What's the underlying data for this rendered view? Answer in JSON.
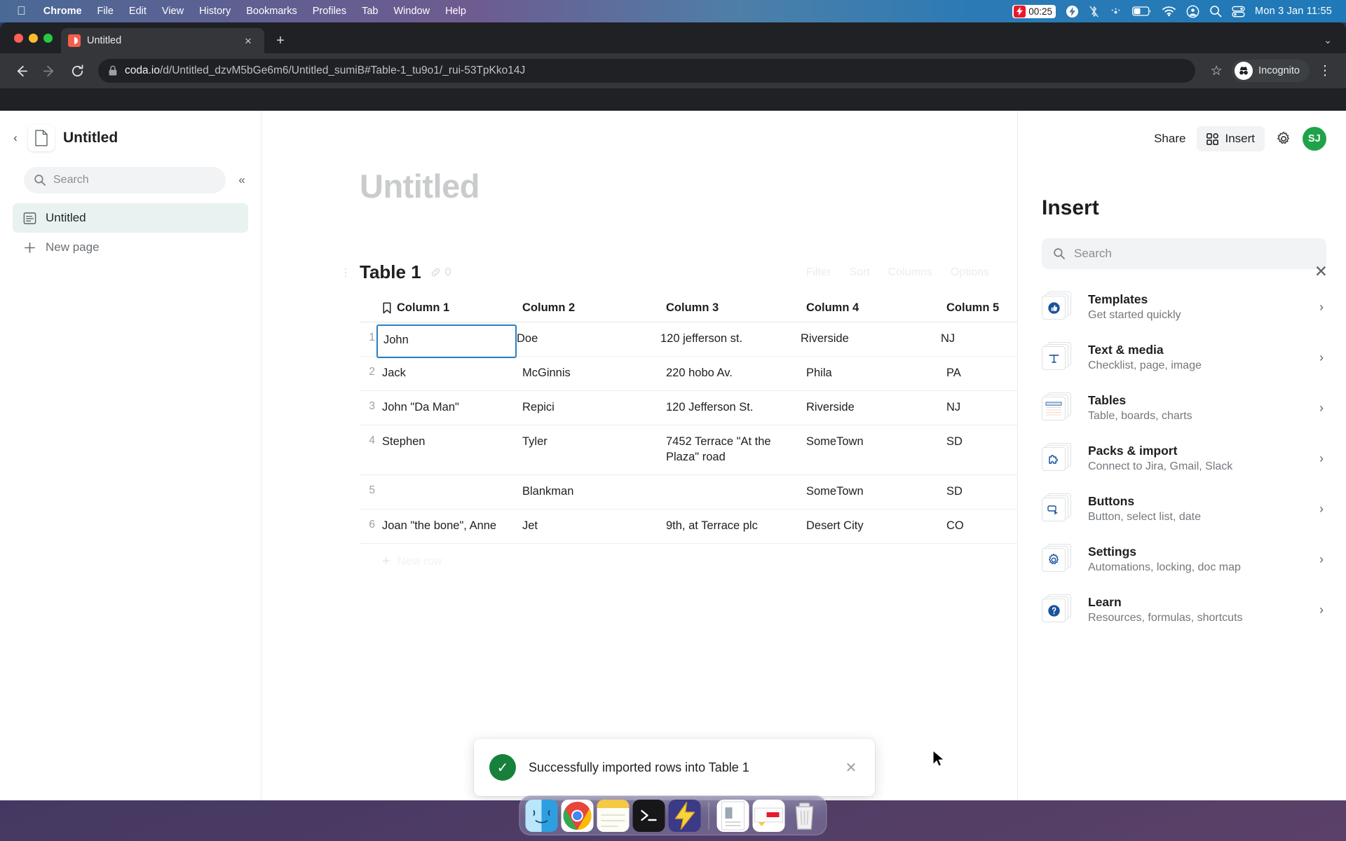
{
  "menubar": {
    "apple_icon": "apple-logo",
    "items": [
      "Chrome",
      "File",
      "Edit",
      "View",
      "History",
      "Bookmarks",
      "Profiles",
      "Tab",
      "Window",
      "Help"
    ],
    "recording_time": "00:25",
    "status_icons": [
      "screen-recording-icon",
      "bolt-icon",
      "bluetooth-icon",
      "brightness-icon",
      "battery-icon",
      "wifi-icon",
      "control-center-icon",
      "spotlight-icon",
      "toggles-icon"
    ],
    "datetime": "Mon 3 Jan  11:55"
  },
  "browser": {
    "tab_title": "Untitled",
    "tab_close_glyph": "×",
    "new_tab_glyph": "+",
    "tabstrip_chevron": "⌄",
    "url_host": "coda.io",
    "url_path": "/d/Untitled_dzvM5bGe6m6/Untitled_sumiB#Table-1_tu9o1/_rui-53TpKko14J",
    "profile_label": "Incognito",
    "bookmark_glyph": "☆",
    "menu_glyph": "⋮"
  },
  "sidebar": {
    "back_glyph": "‹",
    "doc_title": "Untitled",
    "search_placeholder": "Search",
    "collapse_glyph": "«",
    "items": [
      {
        "label": "Untitled",
        "icon": "page-icon",
        "active": true
      },
      {
        "label": "New page",
        "icon": "plus-icon",
        "active": false
      }
    ]
  },
  "doc": {
    "heading_placeholder": "Untitled",
    "table": {
      "name": "Table 1",
      "row_count": "0",
      "tools": [
        "Filter",
        "Sort",
        "Columns",
        "Options"
      ],
      "columns": [
        "Column 1",
        "Column 2",
        "Column 3",
        "Column 4",
        "Column 5"
      ],
      "rows": [
        {
          "n": "1",
          "cells": [
            "John",
            "Doe",
            "120 jefferson st.",
            "Riverside",
            "NJ"
          ]
        },
        {
          "n": "2",
          "cells": [
            "Jack",
            "McGinnis",
            "220 hobo Av.",
            "Phila",
            "PA"
          ]
        },
        {
          "n": "3",
          "cells": [
            "John \"Da Man\"",
            "Repici",
            "120 Jefferson St.",
            "Riverside",
            "NJ"
          ]
        },
        {
          "n": "4",
          "cells": [
            "Stephen",
            "Tyler",
            "7452 Terrace \"At the Plaza\" road",
            "SomeTown",
            "SD"
          ]
        },
        {
          "n": "5",
          "cells": [
            "",
            "Blankman",
            "",
            "SomeTown",
            "SD"
          ]
        },
        {
          "n": "6",
          "cells": [
            "Joan \"the bone\", Anne",
            "Jet",
            "9th, at Terrace plc",
            "Desert City",
            "CO"
          ]
        }
      ],
      "new_row_label": "New row",
      "add_column_glyph": "+",
      "selected_cell": "John"
    }
  },
  "toast": {
    "message": "Successfully imported rows into Table 1",
    "close_glyph": "✕",
    "check_glyph": "✓",
    "status_color": "#17803b"
  },
  "panel": {
    "share_label": "Share",
    "insert_label": "Insert",
    "gear_icon": "gear-icon",
    "avatar_initials": "SJ",
    "avatar_color": "#1fa34a",
    "close_glyph": "✕",
    "title": "Insert",
    "search_placeholder": "Search",
    "chevron_glyph": "›",
    "items": [
      {
        "name": "Templates",
        "sub": "Get started quickly",
        "icon": "thumbs-up-icon"
      },
      {
        "name": "Text & media",
        "sub": "Checklist, page, image",
        "icon": "text-t-icon"
      },
      {
        "name": "Tables",
        "sub": "Table, boards, charts",
        "icon": "table-icon"
      },
      {
        "name": "Packs & import",
        "sub": "Connect to Jira, Gmail, Slack",
        "icon": "puzzle-icon"
      },
      {
        "name": "Buttons",
        "sub": "Button, select list, date",
        "icon": "button-cursor-icon"
      },
      {
        "name": "Settings",
        "sub": "Automations, locking, doc map",
        "icon": "gear-icon"
      },
      {
        "name": "Learn",
        "sub": "Resources, formulas, shortcuts",
        "icon": "question-mark-icon"
      }
    ]
  },
  "dock": {
    "apps": [
      "finder-icon",
      "chrome-icon",
      "stickies-icon",
      "terminal-icon",
      "lightning-app-icon"
    ],
    "recents": [
      "document-icon",
      "clipping-icon",
      "trash-icon"
    ]
  }
}
